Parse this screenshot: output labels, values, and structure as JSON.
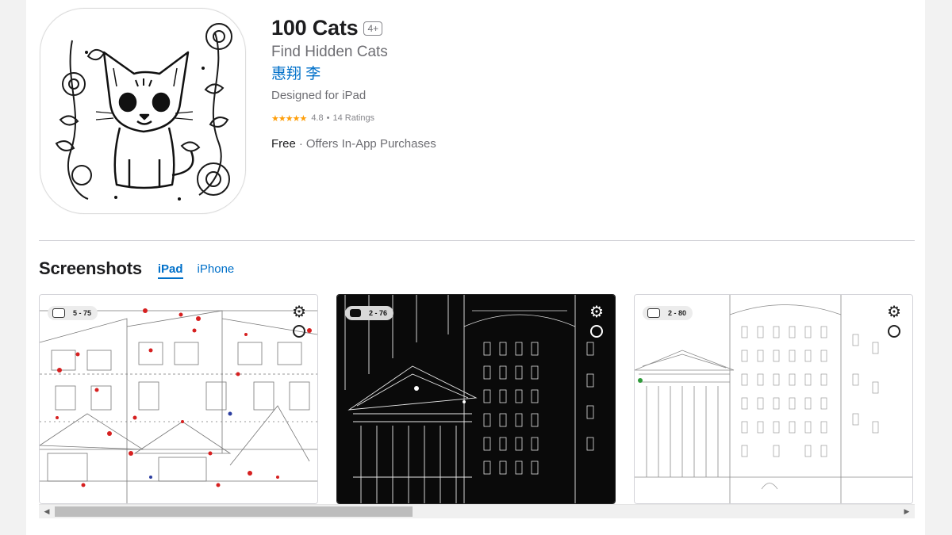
{
  "app": {
    "title": "100 Cats",
    "age_rating": "4+",
    "subtitle": "Find Hidden Cats",
    "developer": "惠翔 李",
    "designed_for": "Designed for iPad",
    "stars": "★★★★★",
    "rating": "4.8",
    "rating_count": "14 Ratings",
    "price": "Free",
    "price_separator": "·",
    "iap": "Offers In-App Purchases"
  },
  "screenshots": {
    "title": "Screenshots",
    "tabs": [
      {
        "label": "iPad",
        "active": true
      },
      {
        "label": "iPhone",
        "active": false
      }
    ],
    "items": [
      {
        "counter": "5 - 75",
        "theme": "light"
      },
      {
        "counter": "2 - 76",
        "theme": "dark"
      },
      {
        "counter": "2 - 80",
        "theme": "light"
      }
    ]
  },
  "colors": {
    "link": "#0070c9",
    "star": "#ff9f0a",
    "text_secondary": "#6e6e73"
  },
  "icons": {
    "gear": "gear-icon",
    "zoom": "zoom-icon",
    "hud_cat": "cat-icon"
  }
}
